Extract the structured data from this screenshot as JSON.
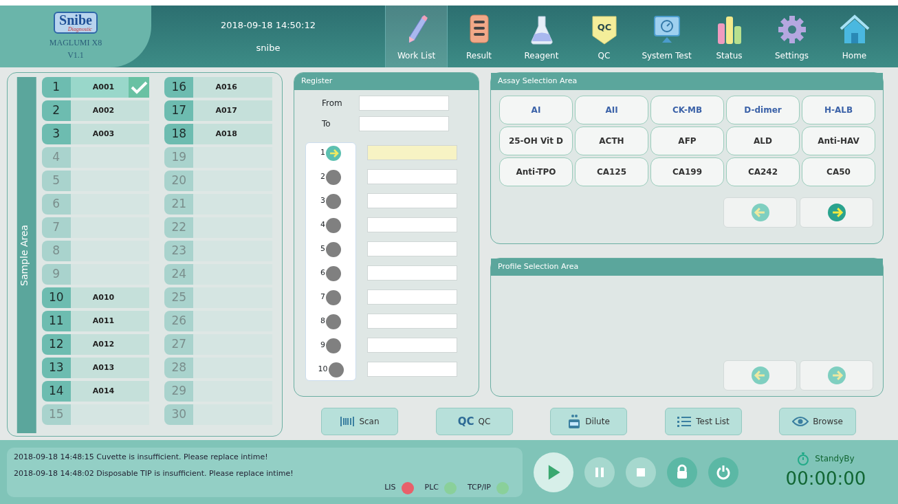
{
  "header": {
    "logo": {
      "text": "Snibe",
      "subtext": "Diagnostic"
    },
    "product": "MAGLUMI X8",
    "version": "V1.1",
    "datetime": "2018-09-18 14:50:12",
    "user": "snibe"
  },
  "nav_tabs": [
    {
      "label": "Work List",
      "kind": "pencil",
      "selected": true
    },
    {
      "label": "Result",
      "kind": "list",
      "selected": false
    },
    {
      "label": "Reagent",
      "kind": "flask",
      "selected": false
    },
    {
      "label": "QC",
      "kind": "qc",
      "icon_text": "QC",
      "selected": false
    },
    {
      "label": "System Test",
      "kind": "monitor",
      "selected": false
    },
    {
      "label": "Status",
      "kind": "bars",
      "selected": false
    },
    {
      "label": "Settings",
      "kind": "gear",
      "selected": false
    },
    {
      "label": "Home",
      "kind": "house",
      "selected": false
    }
  ],
  "sample_area": {
    "title": "Sample Area",
    "slots": [
      {
        "number": "1",
        "sample_id": "A001",
        "filled": true,
        "checked": true
      },
      {
        "number": "2",
        "sample_id": "A002",
        "filled": true,
        "checked": false
      },
      {
        "number": "3",
        "sample_id": "A003",
        "filled": true,
        "checked": false
      },
      {
        "number": "4",
        "filled": false,
        "checked": false
      },
      {
        "number": "5",
        "filled": false,
        "checked": false
      },
      {
        "number": "6",
        "filled": false,
        "checked": false
      },
      {
        "number": "7",
        "filled": false,
        "checked": false
      },
      {
        "number": "8",
        "filled": false,
        "checked": false
      },
      {
        "number": "9",
        "filled": false,
        "checked": false
      },
      {
        "number": "10",
        "sample_id": "A010",
        "filled": true,
        "checked": false
      },
      {
        "number": "11",
        "sample_id": "A011",
        "filled": true,
        "checked": false
      },
      {
        "number": "12",
        "sample_id": "A012",
        "filled": true,
        "checked": false
      },
      {
        "number": "13",
        "sample_id": "A013",
        "filled": true,
        "checked": false
      },
      {
        "number": "14",
        "sample_id": "A014",
        "filled": true,
        "checked": false
      },
      {
        "number": "15",
        "filled": false,
        "checked": false
      },
      {
        "number": "16",
        "sample_id": "A016",
        "filled": true,
        "checked": false
      },
      {
        "number": "17",
        "sample_id": "A017",
        "filled": true,
        "checked": false
      },
      {
        "number": "18",
        "sample_id": "A018",
        "filled": true,
        "checked": false
      },
      {
        "number": "19",
        "filled": false,
        "checked": false
      },
      {
        "number": "20",
        "filled": false,
        "checked": false
      },
      {
        "number": "21",
        "filled": false,
        "checked": false
      },
      {
        "number": "22",
        "filled": false,
        "checked": false
      },
      {
        "number": "23",
        "filled": false,
        "checked": false
      },
      {
        "number": "24",
        "filled": false,
        "checked": false
      },
      {
        "number": "25",
        "filled": false,
        "checked": false
      },
      {
        "number": "26",
        "filled": false,
        "checked": false
      },
      {
        "number": "27",
        "filled": false,
        "checked": false
      },
      {
        "number": "28",
        "filled": false,
        "checked": false
      },
      {
        "number": "29",
        "filled": false,
        "checked": false
      },
      {
        "number": "30",
        "filled": false,
        "checked": false
      }
    ]
  },
  "register": {
    "title": "Register",
    "from_label": "From",
    "to_label": "To",
    "entries": [
      {
        "number": "1",
        "selected": true
      },
      {
        "number": "2",
        "selected": false
      },
      {
        "number": "3",
        "selected": false
      },
      {
        "number": "4",
        "selected": false
      },
      {
        "number": "5",
        "selected": false
      },
      {
        "number": "6",
        "selected": false
      },
      {
        "number": "7",
        "selected": false
      },
      {
        "number": "8",
        "selected": false
      },
      {
        "number": "9",
        "selected": false
      },
      {
        "number": "10",
        "selected": false
      }
    ]
  },
  "assay_area": {
    "title": "Assay Selection Area",
    "assays": [
      {
        "label": "AI",
        "color": "#3b62a8"
      },
      {
        "label": "AII",
        "color": "#3b62a8"
      },
      {
        "label": "CK-MB",
        "color": "#3b62a8"
      },
      {
        "label": "D-dimer",
        "color": "#3b62a8"
      },
      {
        "label": "H-ALB",
        "color": "#3b62a8"
      },
      {
        "label": "25-OH Vit D",
        "color": "#333333"
      },
      {
        "label": "ACTH",
        "color": "#333333"
      },
      {
        "label": "AFP",
        "color": "#333333"
      },
      {
        "label": "ALD",
        "color": "#333333"
      },
      {
        "label": "Anti-HAV",
        "color": "#333333"
      },
      {
        "label": "Anti-TPO",
        "color": "#333333"
      },
      {
        "label": "CA125",
        "color": "#333333"
      },
      {
        "label": "CA199",
        "color": "#333333"
      },
      {
        "label": "CA242",
        "color": "#333333"
      },
      {
        "label": "CA50",
        "color": "#333333"
      }
    ],
    "prev_disabled": true,
    "next_disabled": false
  },
  "profile_area": {
    "title": "Profile Selection Area",
    "prev_disabled": true,
    "next_disabled": true
  },
  "actions": [
    {
      "label": "Scan",
      "kind": "barcode"
    },
    {
      "label": "QC",
      "kind": "qc",
      "icon_text": "QC"
    },
    {
      "label": "Dilute",
      "kind": "dilute"
    },
    {
      "label": "Test List",
      "kind": "list"
    },
    {
      "label": "Browse",
      "kind": "eye"
    }
  ],
  "messages": [
    "2018-09-18 14:48:15  Cuvette is insufficient. Please replace intime!",
    "2018-09-18 14:48:02  Disposable TIP is insufficient. Please replace intime!"
  ],
  "connections": [
    {
      "label": "LIS",
      "color": "#e8606a"
    },
    {
      "label": "PLC",
      "color": "#8ad09a"
    },
    {
      "label": "TCP/IP",
      "color": "#8ad09a"
    }
  ],
  "controls": [
    {
      "kind": "play",
      "disabled": false
    },
    {
      "kind": "pause",
      "disabled": true
    },
    {
      "kind": "stop",
      "disabled": true
    },
    {
      "kind": "lock",
      "disabled": false
    },
    {
      "kind": "power",
      "disabled": false
    }
  ],
  "status": {
    "state": "StandyBy",
    "timer": "00:00:00"
  }
}
